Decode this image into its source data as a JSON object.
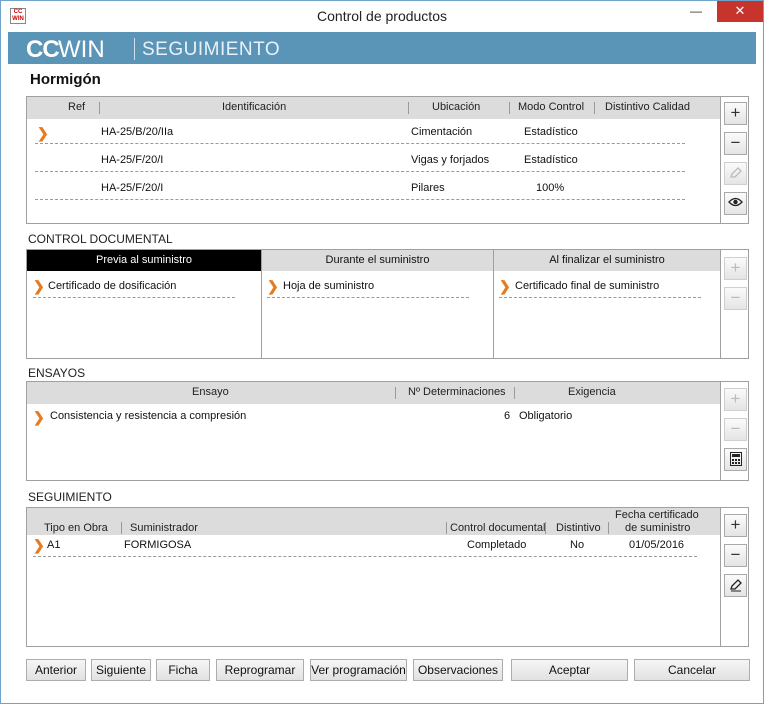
{
  "window": {
    "title": "Control de productos",
    "icon_text_top": "CC",
    "icon_text_bottom": "WIN",
    "min_glyph": "—",
    "max_glyph": "☐",
    "close_glyph": "✕"
  },
  "banner": {
    "logo_cc": "CC",
    "logo_win": "WIN",
    "module": "SEGUIMIENTO"
  },
  "heading": "Hormigón",
  "products": {
    "columns": [
      "Ref",
      "Identificación",
      "Ubicación",
      "Modo Control",
      "Distintivo Calidad"
    ],
    "rows": [
      {
        "ref": "",
        "identificacion": "HA-25/B/20/IIa",
        "ubicacion": "Cimentación",
        "modo": "Estadístico",
        "distintivo": ""
      },
      {
        "ref": "",
        "identificacion": "HA-25/F/20/I",
        "ubicacion": "Vigas y forjados",
        "modo": "Estadístico",
        "distintivo": ""
      },
      {
        "ref": "",
        "identificacion": "HA-25/F/20/I",
        "ubicacion": "Pilares",
        "modo": "100%",
        "distintivo": ""
      }
    ]
  },
  "control_documental": {
    "label": "CONTROL DOCUMENTAL",
    "tabs": [
      "Previa al suministro",
      "Durante el suministro",
      "Al finalizar el suministro"
    ],
    "items": [
      "Certificado de dosificación",
      "Hoja de suministro",
      "Certificado final de suministro"
    ]
  },
  "ensayos": {
    "label": "ENSAYOS",
    "columns": [
      "Ensayo",
      "Nº Determinaciones",
      "Exigencia"
    ],
    "rows": [
      {
        "ensayo": "Consistencia y resistencia a compresión",
        "n": "6",
        "exigencia": "Obligatorio"
      }
    ]
  },
  "seguimiento": {
    "label": "SEGUIMIENTO",
    "columns": [
      "Tipo en Obra",
      "Suministrador",
      "Control documental",
      "Distintivo",
      "Fecha certificado",
      "de suministro"
    ],
    "rows": [
      {
        "tipo": "A1",
        "suministrador": "FORMIGOSA",
        "control": "Completado",
        "distintivo": "No",
        "fecha": "01/05/2016"
      }
    ]
  },
  "buttons": {
    "anterior": "Anterior",
    "siguiente": "Siguiente",
    "ficha": "Ficha",
    "reprogramar": "Reprogramar",
    "ver_programacion": "Ver programación",
    "observaciones": "Observaciones",
    "aceptar": "Aceptar",
    "cancelar": "Cancelar"
  },
  "icons": {
    "add": "plus-icon",
    "remove": "minus-icon",
    "edit": "pencil-icon",
    "view": "eye-icon",
    "calc": "calculator-icon",
    "row_marker": "chevron-right-icon"
  },
  "colors": {
    "banner": "#5a95b8",
    "accent_arrow": "#e87a1e",
    "close": "#c6342b",
    "active_tab": "#000000"
  }
}
